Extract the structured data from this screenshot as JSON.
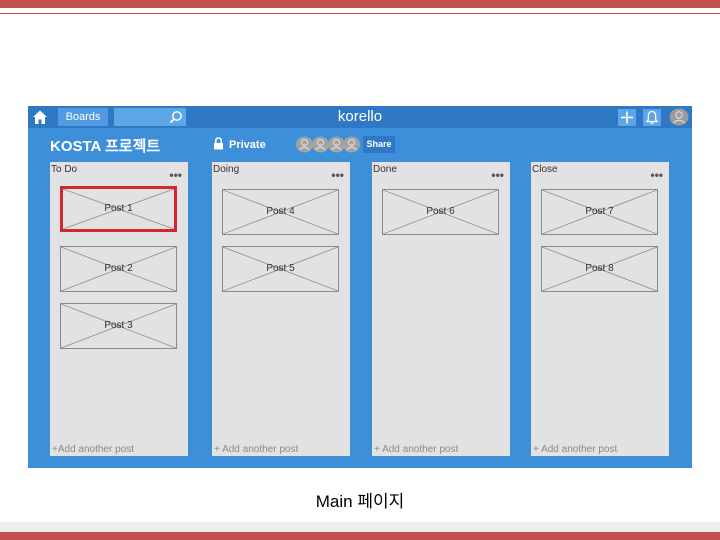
{
  "appbar": {
    "boards_label": "Boards",
    "brand": "korello",
    "icons": [
      "home-icon",
      "search-icon",
      "plus-icon",
      "bell-icon",
      "user-icon"
    ]
  },
  "board": {
    "title": "KOSTA 프로젝트",
    "visibility": "Private",
    "share_label": "Share",
    "member_count_shown": 4
  },
  "lists": [
    {
      "title": "To Do",
      "menu": "•••",
      "cards": [
        "Post 1",
        "Post 2",
        "Post 3"
      ],
      "add_label": "+Add another post"
    },
    {
      "title": "Doing",
      "menu": "•••",
      "cards": [
        "Post 4",
        "Post 5"
      ],
      "add_label": "+ Add another post"
    },
    {
      "title": "Done",
      "menu": "•••",
      "cards": [
        "Post 6"
      ],
      "add_label": "+ Add another post"
    },
    {
      "title": "Close",
      "menu": "•••",
      "cards": [
        "Post 7",
        "Post 8"
      ],
      "add_label": "+ Add another post"
    }
  ],
  "highlighted_card": "Post 1",
  "caption": "Main 페이지",
  "colors": {
    "accent": "#c0504d",
    "app_background": "#3d8fd9",
    "appbar": "#2f78c6",
    "list_background": "#e2e2e2",
    "highlight": "#d22630"
  }
}
